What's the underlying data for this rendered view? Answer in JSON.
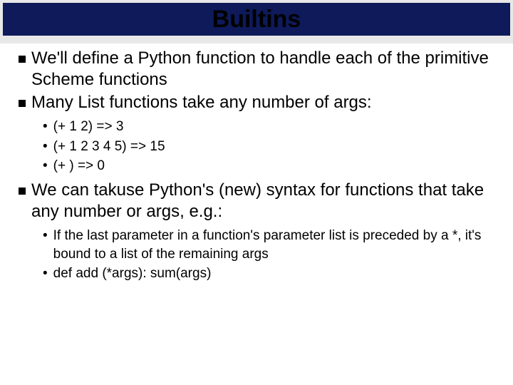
{
  "title": "Builtins",
  "bullets": [
    {
      "text": "We'll define a Python function to handle each of the primitive Scheme functions"
    },
    {
      "text": "Many List functions take any number of args:",
      "sub": [
        "(+ 1 2) => 3",
        "(+ 1 2 3 4 5) => 15",
        "(+ ) => 0"
      ]
    },
    {
      "text": "We can takuse Python's (new) syntax for functions that take any number or args, e.g.:",
      "sub": [
        "If the last parameter in a function's parameter list is preceded by a *, it's bound to a list of the remaining args",
        "def add (*args): sum(args)"
      ]
    }
  ]
}
